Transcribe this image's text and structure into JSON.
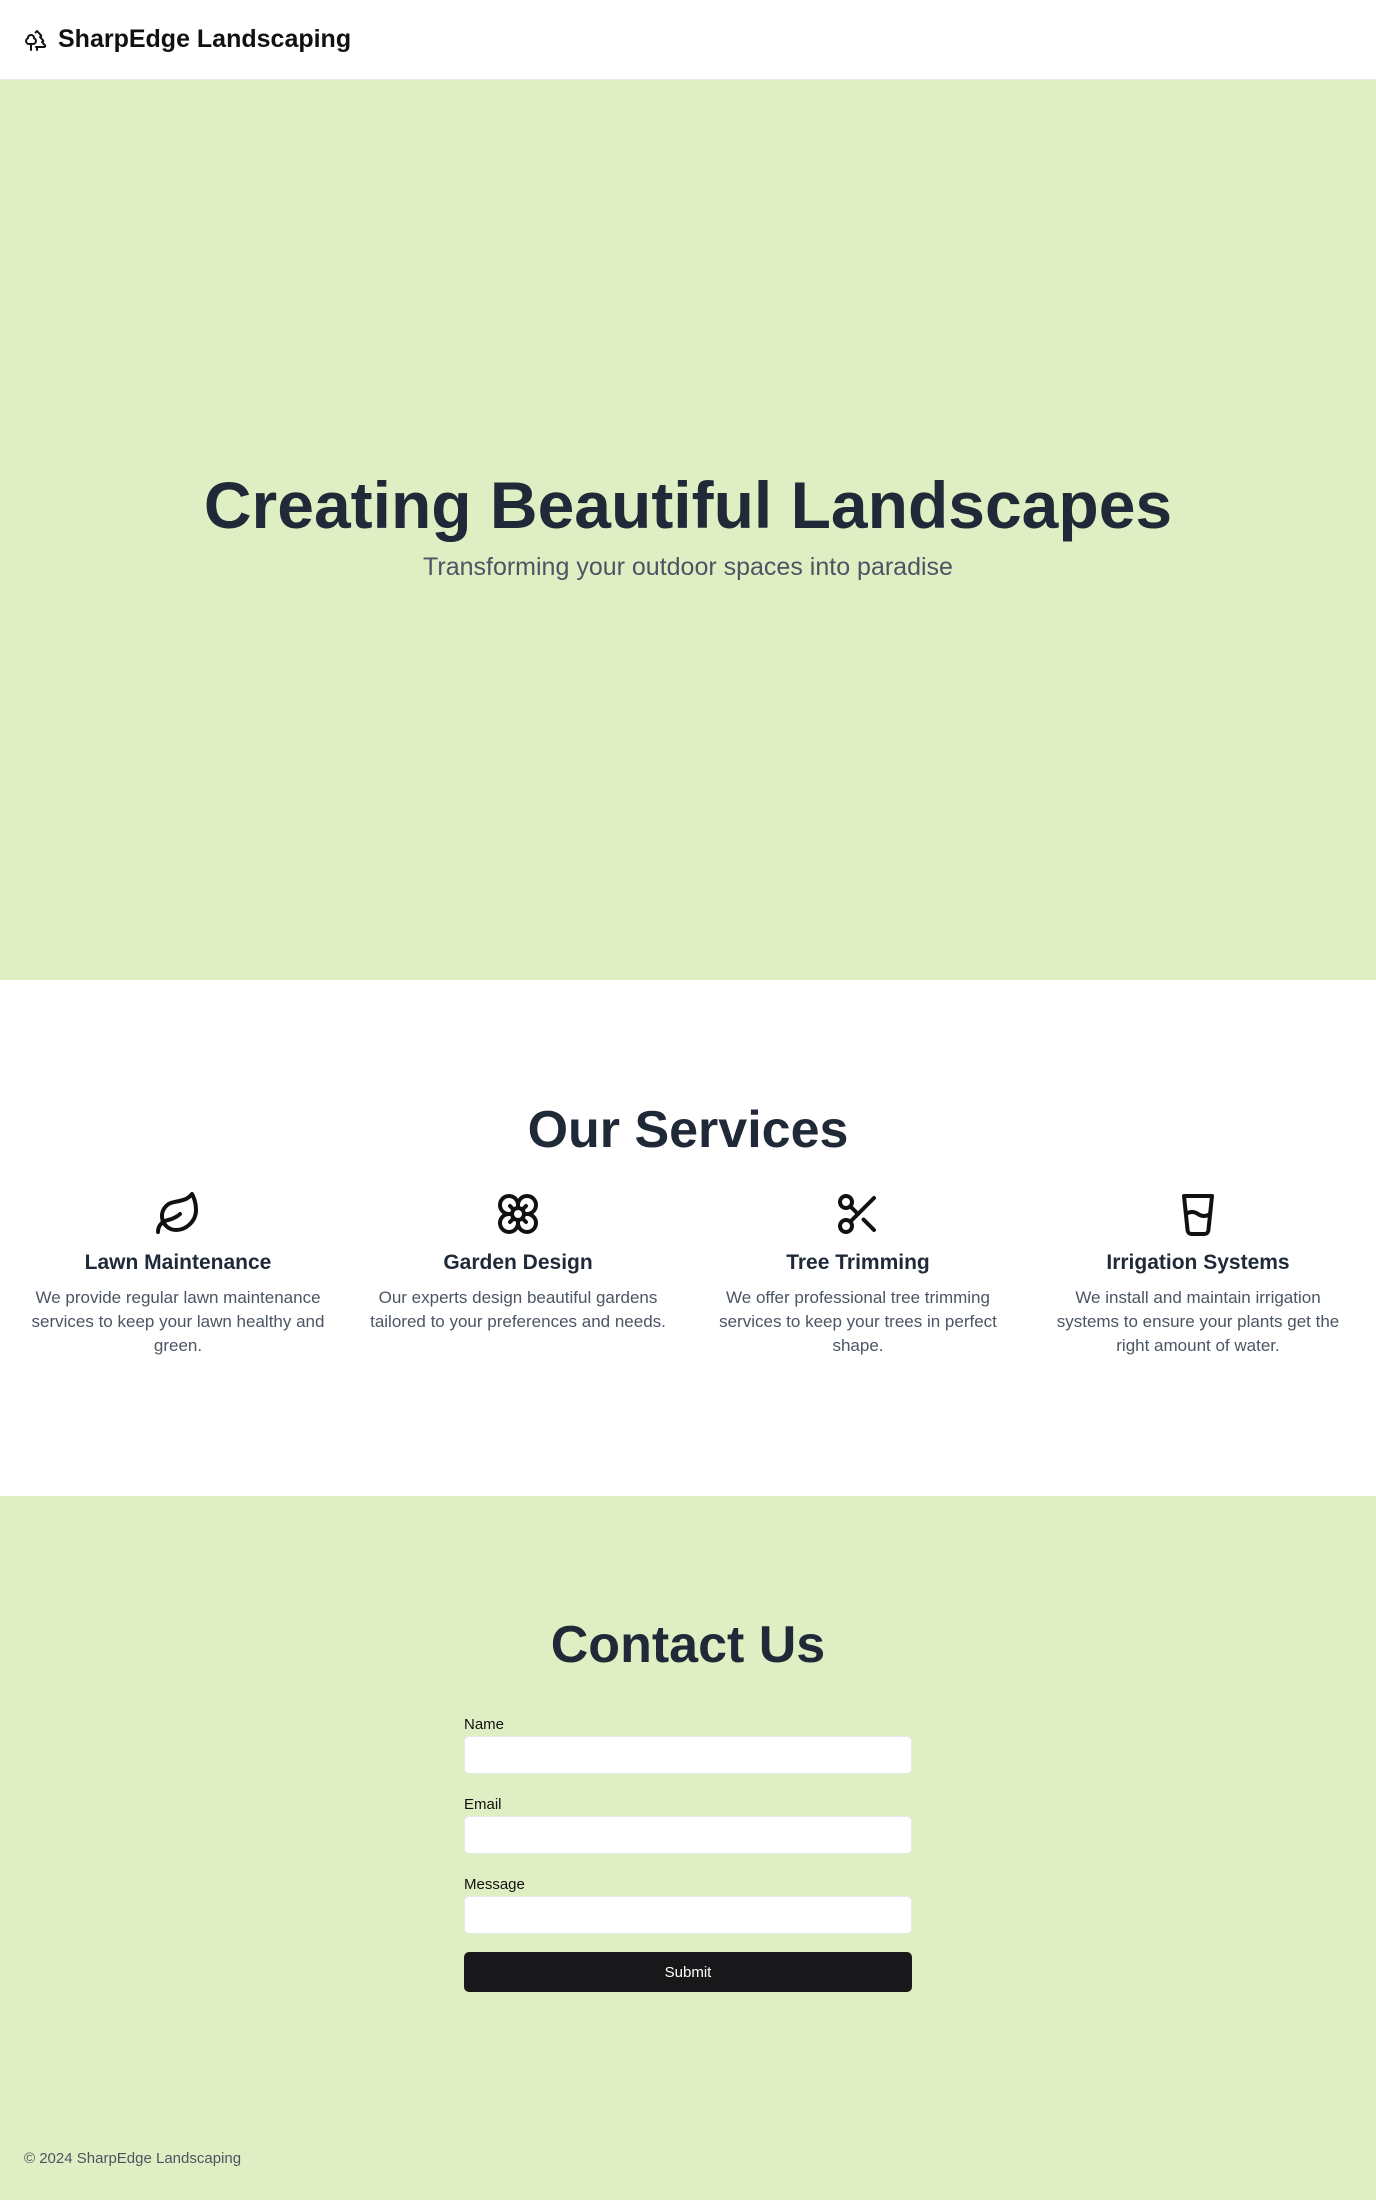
{
  "header": {
    "brand_name": "SharpEdge Landscaping",
    "brand_icon": "trees-icon"
  },
  "hero": {
    "title": "Creating Beautiful Landscapes",
    "subtitle": "Transforming your outdoor spaces into paradise"
  },
  "services": {
    "title": "Our Services",
    "items": [
      {
        "icon": "leaf-icon",
        "name": "Lawn Maintenance",
        "description": "We provide regular lawn maintenance services to keep your lawn healthy and green."
      },
      {
        "icon": "flower-icon",
        "name": "Garden Design",
        "description": "Our experts design beautiful gardens tailored to your preferences and needs."
      },
      {
        "icon": "scissors-icon",
        "name": "Tree Trimming",
        "description": "We offer professional tree trimming services to keep your trees in perfect shape."
      },
      {
        "icon": "glass-water-icon",
        "name": "Irrigation Systems",
        "description": "We install and maintain irrigation systems to ensure your plants get the right amount of water."
      }
    ]
  },
  "contact": {
    "title": "Contact Us",
    "fields": {
      "name_label": "Name",
      "name_value": "",
      "email_label": "Email",
      "email_value": "",
      "message_label": "Message",
      "message_value": ""
    },
    "submit_label": "Submit"
  },
  "footer": {
    "copyright": "© 2024 SharpEdge Landscaping"
  },
  "colors": {
    "accent_background": "#e0efc3",
    "heading": "#1f2937",
    "body_text": "#4b5563",
    "button": "#18181b"
  }
}
